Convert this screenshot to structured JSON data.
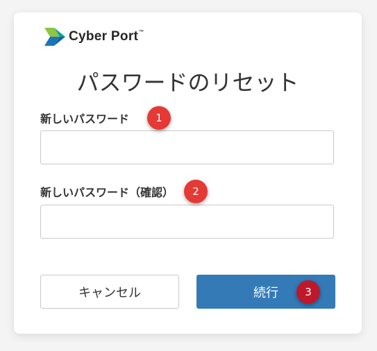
{
  "brand": {
    "name": "Cyber Port",
    "trademark": "™"
  },
  "page": {
    "title": "パスワードのリセット"
  },
  "form": {
    "new_password_label": "新しいパスワード",
    "new_password_value": "",
    "confirm_password_label": "新しいパスワード（確認）",
    "confirm_password_value": ""
  },
  "buttons": {
    "cancel_label": "キャンセル",
    "continue_label": "続行"
  },
  "markers": [
    "1",
    "2",
    "3"
  ],
  "colors": {
    "primary": "#337ab7",
    "marker": "#e53935",
    "logo_green": "#8dc63f",
    "logo_teal": "#00a79d",
    "logo_blue": "#1c75bc"
  }
}
